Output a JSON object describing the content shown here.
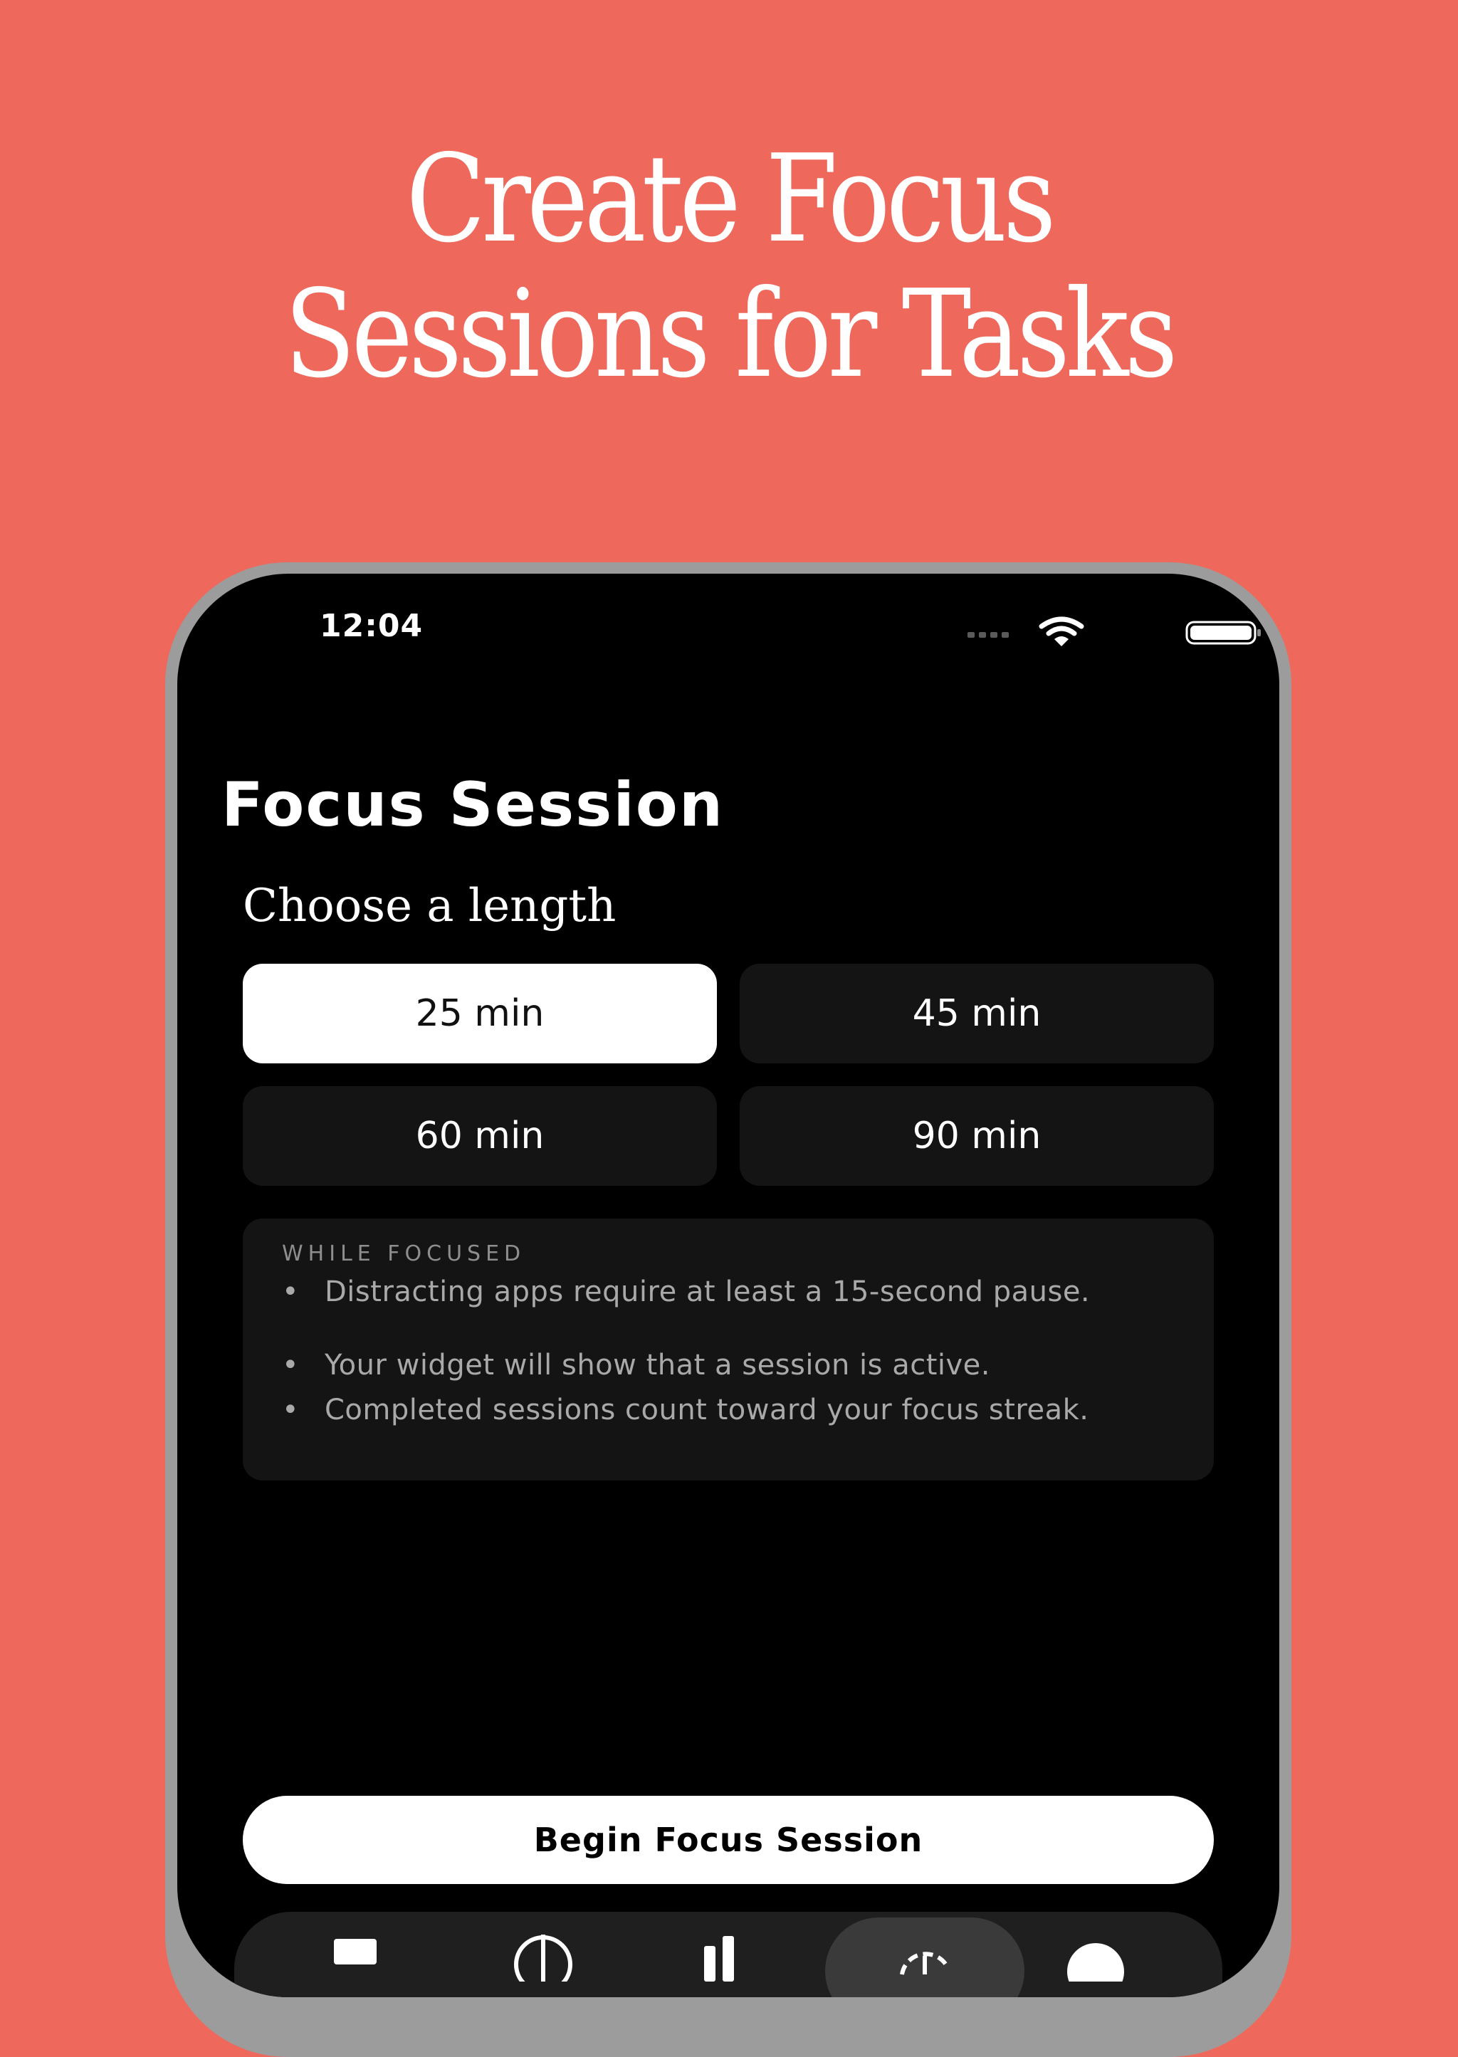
{
  "colors": {
    "background": "#EE695B",
    "screen": "#000000",
    "card": "#141414",
    "selected": "#FFFFFF"
  },
  "headline": {
    "line1": "Create Focus",
    "line2": "Sessions for Tasks"
  },
  "status_bar": {
    "time": "12:04",
    "icons": [
      "cellular-signal-icon",
      "wifi-icon",
      "battery-icon"
    ]
  },
  "screen": {
    "title": "Focus Session",
    "subtitle": "Choose a length",
    "options": [
      {
        "label": "25 min",
        "selected": true
      },
      {
        "label": "45 min",
        "selected": false
      },
      {
        "label": "60 min",
        "selected": false
      },
      {
        "label": "90 min",
        "selected": false
      }
    ],
    "info": {
      "label": "WHILE FOCUSED",
      "bullets": [
        "Distracting apps require at least a 15-second pause.",
        "Your widget will show that a session is active.",
        "Completed sessions count toward your focus streak."
      ]
    },
    "cta_label": "Begin Focus Session",
    "tab_icons": [
      "list-icon",
      "globe-icon",
      "stats-icon",
      "focus-timer-icon",
      "profile-icon"
    ],
    "active_tab": "focus-timer-icon"
  }
}
